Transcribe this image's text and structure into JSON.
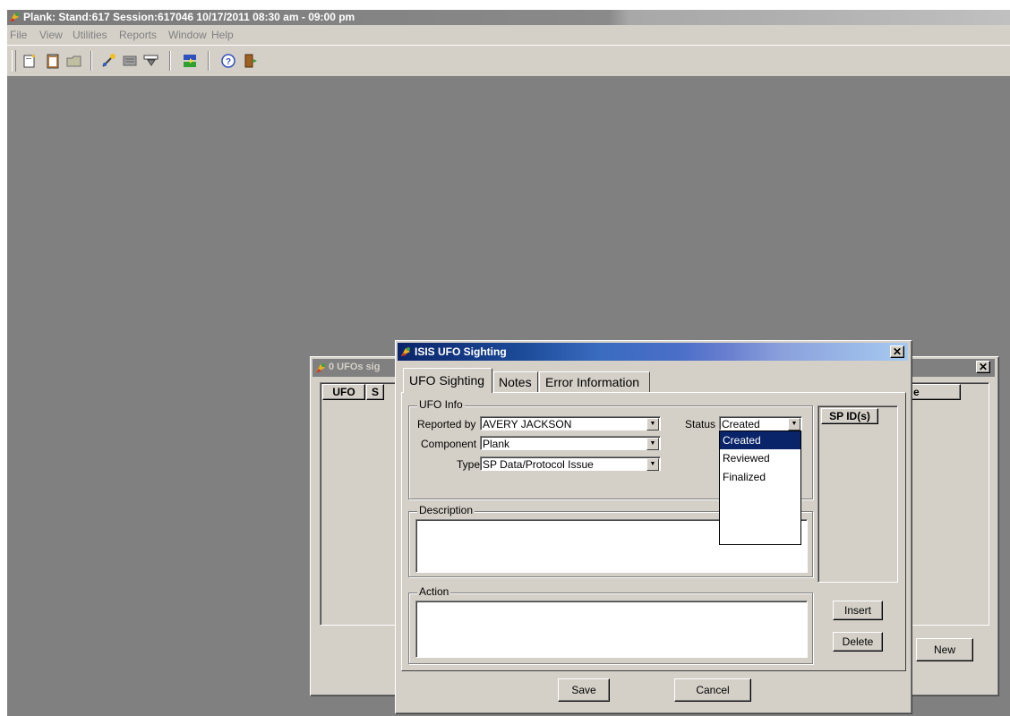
{
  "app": {
    "title": "Plank: Stand:617 Session:617046 10/17/2011 08:30 am - 09:00 pm",
    "menu": [
      "File",
      "View",
      "Utilities",
      "Reports",
      "Window",
      "Help"
    ]
  },
  "toolbar": {
    "icons": [
      "new-icon",
      "clipboard-icon",
      "open-folder-icon",
      "edit-wand-icon",
      "list-icon",
      "filter-icon",
      "transfer-icon",
      "help-icon",
      "exit-door-icon"
    ]
  },
  "bg_window": {
    "title": "0 UFOs sig",
    "columns": [
      "UFO",
      "S"
    ],
    "right_column": "e",
    "new_label": "New"
  },
  "dialog": {
    "title": "ISIS UFO Sighting",
    "tabs": [
      "UFO Sighting",
      "Notes",
      "Error Information"
    ],
    "ufo_info_label": "UFO Info",
    "reported_by_label": "Reported by",
    "reported_by_value": "AVERY JACKSON",
    "component_label": "Component",
    "component_value": "Plank",
    "type_label": "Type",
    "type_value": "SP Data/Protocol Issue",
    "status_label": "Status",
    "status_value": "Created",
    "status_options": [
      "Created",
      "Reviewed",
      "Finalized"
    ],
    "sp_ids_label": "SP ID(s)",
    "description_label": "Description",
    "action_label": "Action",
    "insert_label": "Insert",
    "delete_label": "Delete",
    "save_label": "Save",
    "cancel_label": "Cancel"
  },
  "colors": {
    "desktop": "#808080",
    "face": "#d4d0c8",
    "titlebar_active": "#0a246a",
    "titlebar_inactive": "#808080",
    "selection": "#0a246a"
  }
}
